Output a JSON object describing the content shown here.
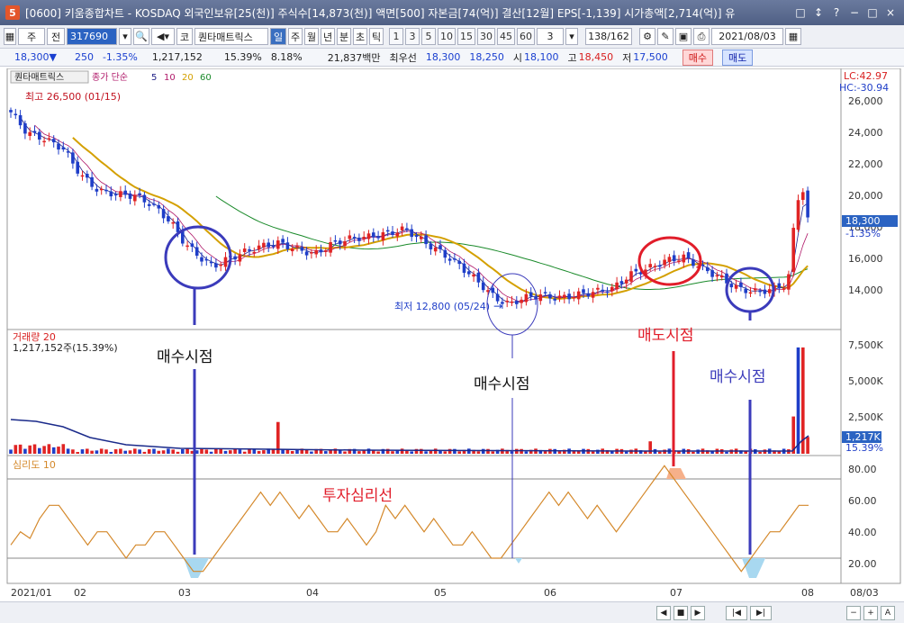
{
  "window": {
    "app_icon": "5",
    "title": "[0600] 키움종합차트 - KOSDAQ 외국인보유[25(천)] 주식수[14,873(천)] 액면[500] 자본금[74(억)] 결산[12월] EPS[-1,139] 시가총액[2,714(억)] 유",
    "buttons": [
      "□",
      "↕",
      "?",
      "−",
      "□",
      "×"
    ]
  },
  "toolbar": {
    "type_select": "주",
    "prev_label": "전",
    "code": "317690",
    "search_icon": "magnifier-icon",
    "sound_icon": "speaker-icon",
    "market_label": "코",
    "stock_name": "퀀타매트릭스",
    "periods": [
      "일",
      "주",
      "월",
      "년",
      "분",
      "초",
      "틱"
    ],
    "selected_period": "일",
    "numbers": [
      "1",
      "3",
      "5",
      "10",
      "15",
      "30",
      "45",
      "60"
    ],
    "count_select": "3",
    "page_counter": "138/162",
    "date": "2021/08/03"
  },
  "quote": {
    "price": "18,300▼",
    "change": "250",
    "change_pct": "-1.35%",
    "volume": "1,217,152",
    "volume_pct": "15.39%",
    "turnover": "8.18%",
    "amount": "21,837백만",
    "best_ask_label": "최우선",
    "best_ask": "18,300",
    "best_bid": "18,250",
    "open_label": "시",
    "open": "18,100",
    "high_label": "고",
    "high": "18,450",
    "low_label": "저",
    "low": "17,500",
    "buy_button": "매수",
    "sell_button": "매도"
  },
  "price_panel": {
    "name_tag": "퀀타매트릭스",
    "legend_label": "종가 단순",
    "ma_periods": [
      "5",
      "10",
      "20",
      "60"
    ],
    "ma_colors": [
      "#222288",
      "#b01a6a",
      "#d4a000",
      "#1a8a2a"
    ],
    "top_right": [
      "LC:42.97",
      "HC:-30.94"
    ],
    "high_note": "최고 26,500 (01/15)",
    "low_note": "최저 12,800 (05/24)",
    "y_ticks": [
      "26,000",
      "24,000",
      "22,000",
      "20,000",
      "18,000",
      "16,000",
      "14,000"
    ],
    "current_price": "18,300",
    "current_pct": "-1.35%"
  },
  "volume_panel": {
    "label": "거래량 20",
    "value_line": "1,217,152주(15.39%)",
    "y_ticks": [
      "7,500K",
      "5,000K",
      "2,500K"
    ],
    "current": "1,217K",
    "current_pct": "15.39%"
  },
  "sentiment_panel": {
    "label": "심리도 10",
    "y_ticks": [
      "80.00",
      "60.00",
      "40.00",
      "20.00"
    ],
    "center_label": "투자심리선"
  },
  "x_axis": [
    "2021/01",
    "02",
    "03",
    "04",
    "05",
    "06",
    "07",
    "08",
    "08/03"
  ],
  "annotations": {
    "buy1": "매수시점",
    "buy2": "매수시점",
    "sell": "매도시점",
    "buy3": "매수시점"
  },
  "colors": {
    "up": "#e02424",
    "down": "#1f3ec8",
    "annotation_blue": "#3b3bbb",
    "annotation_red": "#e11d2a",
    "sentiment_line": "#d4882a"
  },
  "bottom_buttons": [
    "◀",
    "■",
    "▶",
    "|◀",
    "▶|",
    "−",
    "+",
    "A"
  ]
}
